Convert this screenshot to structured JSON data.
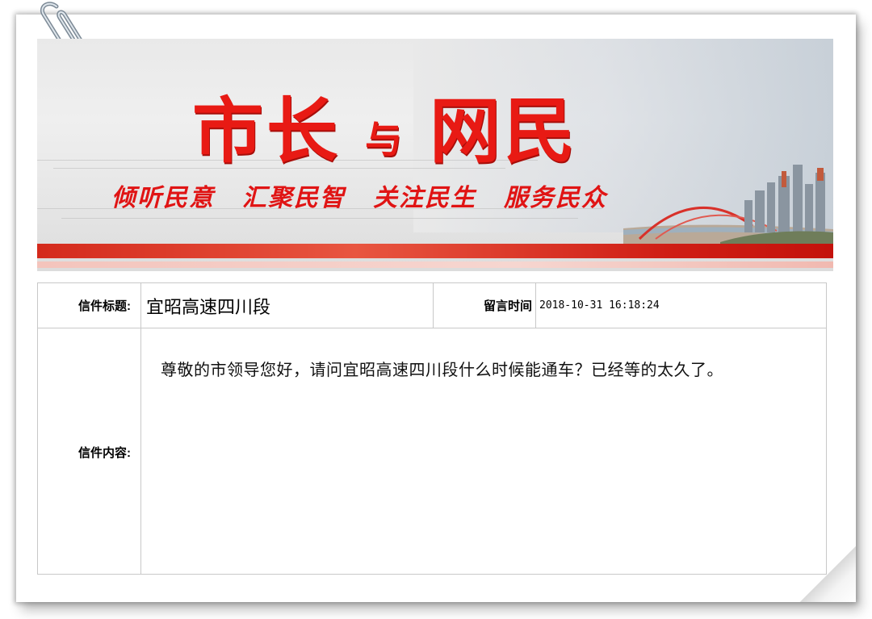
{
  "banner": {
    "title_left": "市长",
    "title_middle": "与",
    "title_right": "网民",
    "slogans": [
      "倾听民意",
      "汇聚民智",
      "关注民生",
      "服务民众"
    ]
  },
  "letter": {
    "subject_label": "信件标题:",
    "subject_value": "宜昭高速四川段",
    "time_label": "留言时间",
    "time_value": "2018-10-31 16:18:24",
    "content_label": "信件内容:",
    "content_value": "尊敬的市领导您好，请问宜昭高速四川段什么时候能通车？已经等的太久了。"
  }
}
